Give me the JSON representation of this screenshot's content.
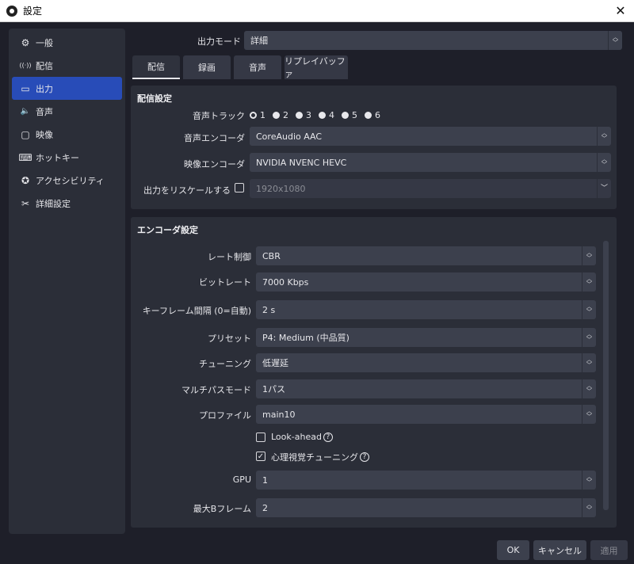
{
  "window": {
    "title": "設定",
    "close": "✕"
  },
  "sidebar": {
    "items": [
      {
        "label": "一般",
        "icon": "⚙"
      },
      {
        "label": "配信",
        "icon": "((·))"
      },
      {
        "label": "出力",
        "icon": "▭"
      },
      {
        "label": "音声",
        "icon": "🔈"
      },
      {
        "label": "映像",
        "icon": "▢"
      },
      {
        "label": "ホットキー",
        "icon": "⌨"
      },
      {
        "label": "アクセシビリティ",
        "icon": "✪"
      },
      {
        "label": "詳細設定",
        "icon": "✂"
      }
    ],
    "active_index": 2
  },
  "output_mode": {
    "label": "出力モード",
    "value": "詳細"
  },
  "tabs": [
    "配信",
    "録画",
    "音声",
    "リプレイバッファ"
  ],
  "streaming": {
    "title": "配信設定",
    "audio_track_label": "音声トラック",
    "tracks": [
      "1",
      "2",
      "3",
      "4",
      "5",
      "6"
    ],
    "selected_track": "1",
    "audio_encoder_label": "音声エンコーダ",
    "audio_encoder": "CoreAudio AAC",
    "video_encoder_label": "映像エンコーダ",
    "video_encoder": "NVIDIA NVENC HEVC",
    "rescale_label": "出力をリスケールする",
    "rescale_value": "1920x1080"
  },
  "encoder": {
    "title": "エンコーダ設定",
    "rate_control_label": "レート制御",
    "rate_control": "CBR",
    "bitrate_label": "ビットレート",
    "bitrate": "7000 Kbps",
    "keyframe_label": "キーフレーム間隔 (0=自動)",
    "keyframe": "2 s",
    "preset_label": "プリセット",
    "preset": "P4: Medium (中品質)",
    "tuning_label": "チューニング",
    "tuning": "低遅延",
    "multipass_label": "マルチパスモード",
    "multipass": "1パス",
    "profile_label": "プロファイル",
    "profile": "main10",
    "lookahead_label": "Look-ahead",
    "lookahead_checked": false,
    "psycho_label": "心理視覚チューニング",
    "psycho_checked": true,
    "gpu_label": "GPU",
    "gpu": "1",
    "bframes_label": "最大Bフレーム",
    "bframes": "2"
  },
  "buttons": {
    "ok": "OK",
    "cancel": "キャンセル",
    "apply": "適用"
  }
}
